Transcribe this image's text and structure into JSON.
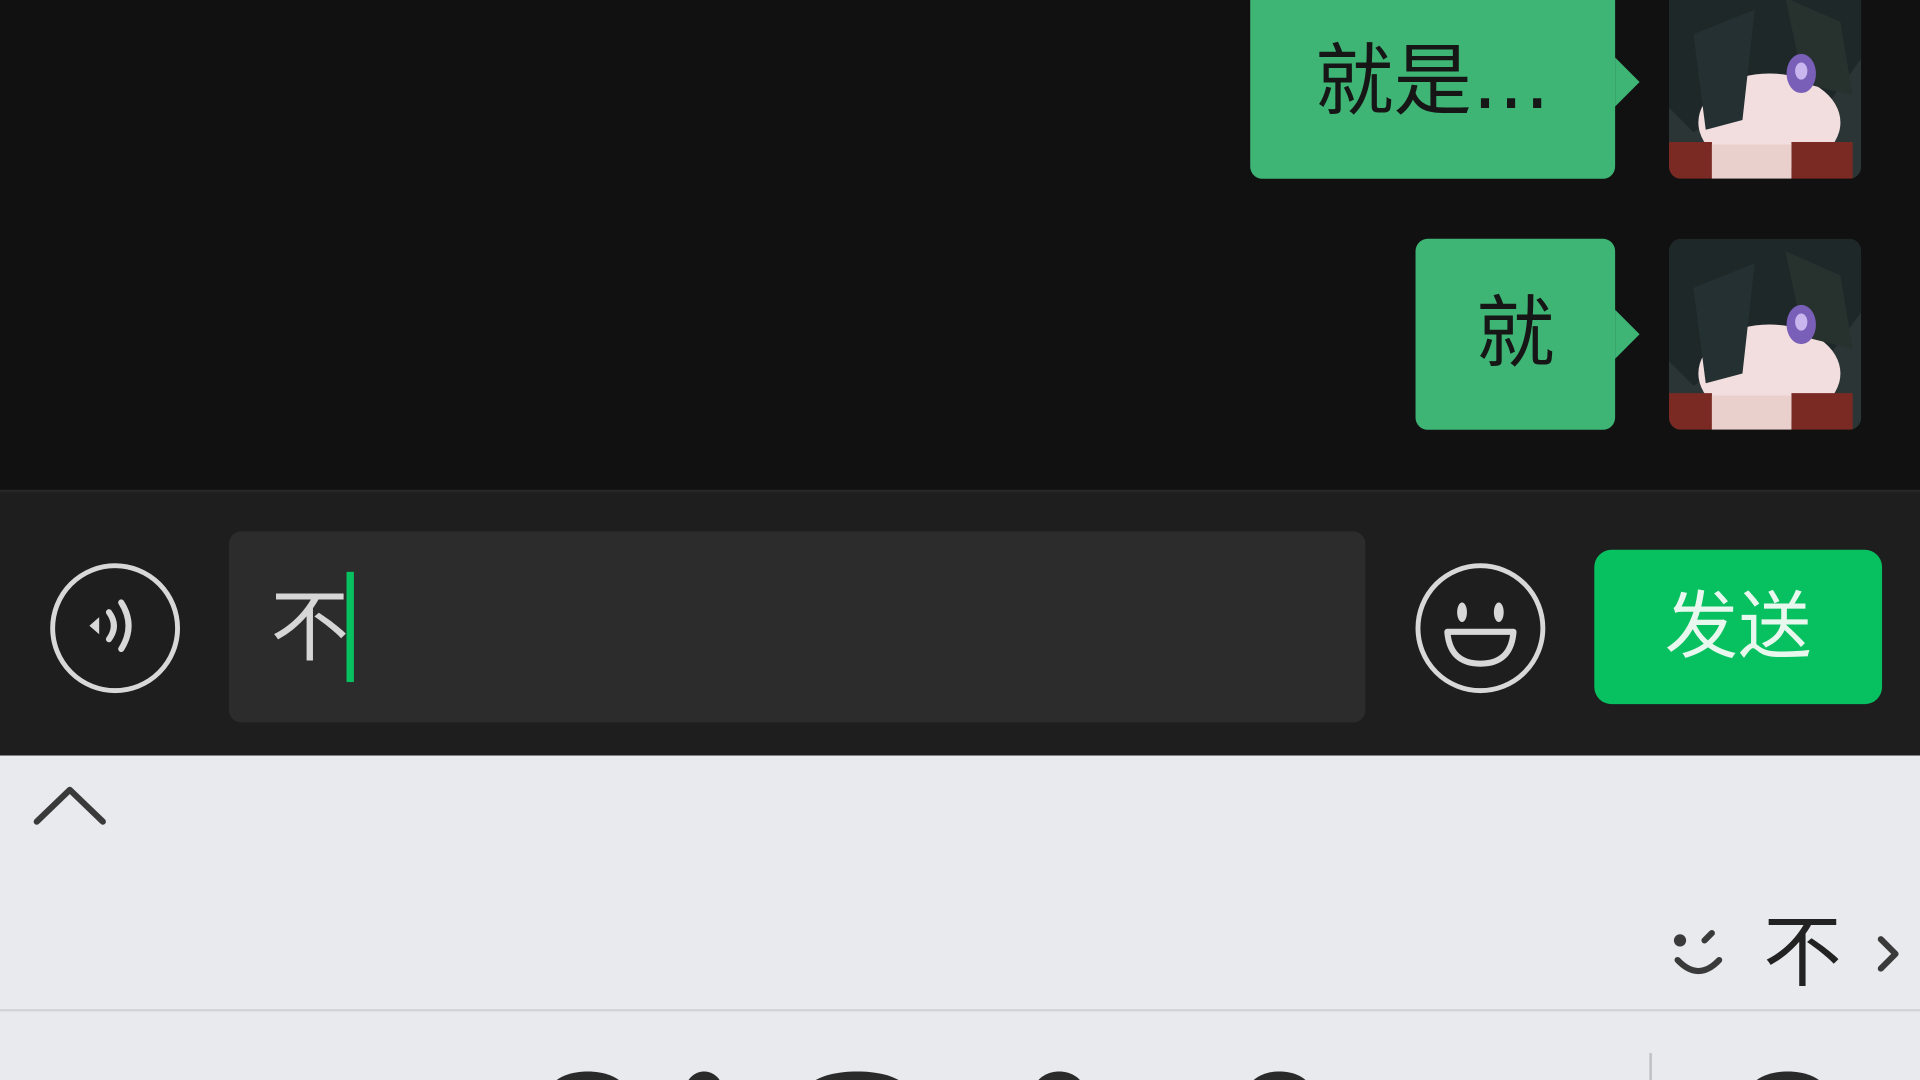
{
  "chat": {
    "messages": [
      {
        "sender": "me",
        "text": "就是…"
      },
      {
        "sender": "me",
        "text": "就"
      }
    ]
  },
  "input_bar": {
    "voice_icon": "voice-icon",
    "input_value": "不",
    "emoji_icon": "emoji-icon",
    "send_label": "发送"
  },
  "keyboard": {
    "collapse_icon": "chevron-up-icon",
    "candidates": [
      "不"
    ],
    "face_icon": "emoticon-face-icon",
    "expand_icon": "chevron-right-icon"
  },
  "colors": {
    "bubble": "#3eb575",
    "send": "#07c160",
    "chat_background": "#111111",
    "input_bar": "#1e1e1e",
    "keyboard": "#e9eaee"
  }
}
